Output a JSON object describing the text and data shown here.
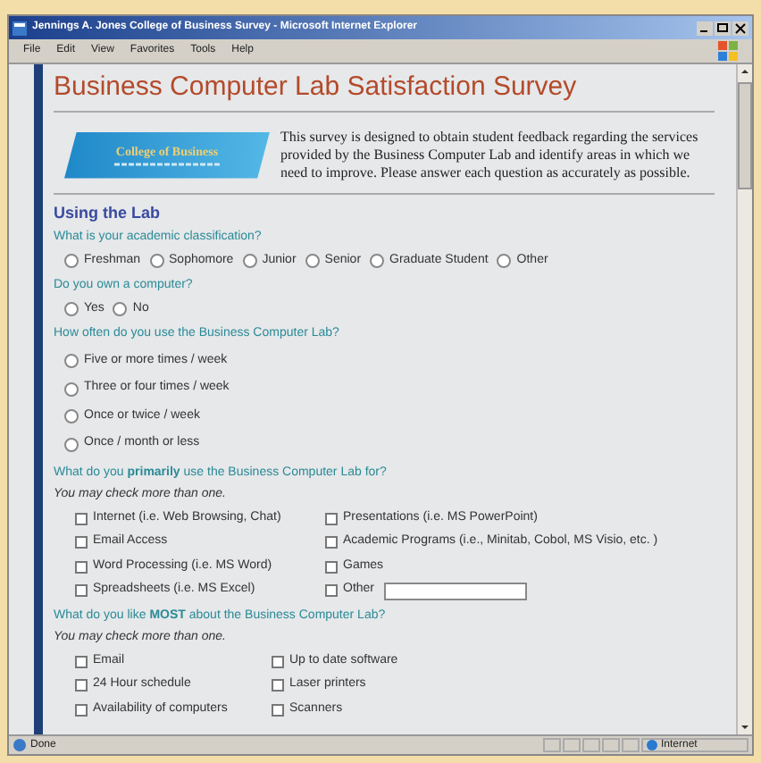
{
  "window": {
    "title": "Jennings A. Jones College of Business Survey - Microsoft Internet Explorer"
  },
  "menu": [
    "File",
    "Edit",
    "View",
    "Favorites",
    "Tools",
    "Help"
  ],
  "page": {
    "heading": "Business Computer Lab Satisfaction Survey",
    "logo_text": "College of Business",
    "intro": "This survey is designed to obtain student feedback regarding the services provided by the Business Computer Lab and identify areas in which we need to improve. Please answer each question as accurately as possible.",
    "section": "Using the Lab",
    "questions": [
      {
        "text": "What is your academic classification?",
        "kind": "inline",
        "options": [
          {
            "kind": "radio",
            "label": "Freshman",
            "selected": false
          },
          {
            "kind": "radio",
            "label": "Sophomore",
            "selected": false
          },
          {
            "kind": "radio",
            "label": "Junior",
            "selected": false
          },
          {
            "kind": "radio",
            "label": "Senior",
            "selected": false
          },
          {
            "kind": "radio",
            "label": "Graduate Student",
            "selected": false
          },
          {
            "kind": "radio",
            "label": "Other",
            "selected": false
          }
        ]
      },
      {
        "text": "Do you own a computer?",
        "kind": "inline",
        "options": [
          {
            "kind": "radio",
            "label": "Yes",
            "selected": false
          },
          {
            "kind": "radio",
            "label": "No",
            "selected": false
          }
        ]
      },
      {
        "text": "How often do you use the Business Computer Lab?",
        "kind": "list",
        "options": [
          {
            "kind": "radio",
            "label": "Five or more times / week",
            "selected": false
          },
          {
            "kind": "radio",
            "label": "Three or four times / week",
            "selected": false
          },
          {
            "kind": "radio",
            "label": "Once or twice / week",
            "selected": false
          },
          {
            "kind": "radio",
            "label": "Once / month or less",
            "selected": false
          }
        ]
      },
      {
        "text": "What do you **primarily** use the Business Computer Lab for?",
        "hint": "You may check more than one.",
        "kind": "grid",
        "options": [
          {
            "kind": "checkbox",
            "label": "Internet (i.e. Web Browsing, Chat)",
            "checked": false
          },
          {
            "kind": "checkbox",
            "label": "Presentations (i.e. MS PowerPoint)",
            "checked": false
          },
          {
            "kind": "checkbox",
            "label": "Email Access",
            "checked": false
          },
          {
            "kind": "checkbox",
            "label": "Academic Programs (i.e., Minitab, Cobol, MS Visio, etc. )",
            "checked": false
          },
          {
            "kind": "checkbox",
            "label": "Word Processing (i.e. MS Word)",
            "checked": false
          },
          {
            "kind": "checkbox",
            "label": "Games",
            "checked": false
          },
          {
            "kind": "checkbox",
            "label": "Spreadsheets (i.e. MS Excel)",
            "checked": false
          },
          {
            "kind": "checkbox_field",
            "label": "Other",
            "checked": false
          }
        ]
      },
      {
        "text": "What do you like **MOST** about the Business Computer Lab?",
        "hint": "You may check more than one.",
        "kind": "grid_narrow",
        "options": [
          {
            "kind": "checkbox",
            "label": "Email",
            "checked": false
          },
          {
            "kind": "checkbox",
            "label": "Up to date software",
            "checked": false
          },
          {
            "kind": "checkbox",
            "label": "24 Hour schedule",
            "checked": false
          },
          {
            "kind": "checkbox",
            "label": "Laser printers",
            "checked": false
          },
          {
            "kind": "checkbox",
            "label": "Availability of computers",
            "checked": false
          },
          {
            "kind": "checkbox",
            "label": "Scanners",
            "checked": false
          }
        ]
      }
    ]
  },
  "status_bar": {
    "text": "Done",
    "zone": "Internet"
  }
}
